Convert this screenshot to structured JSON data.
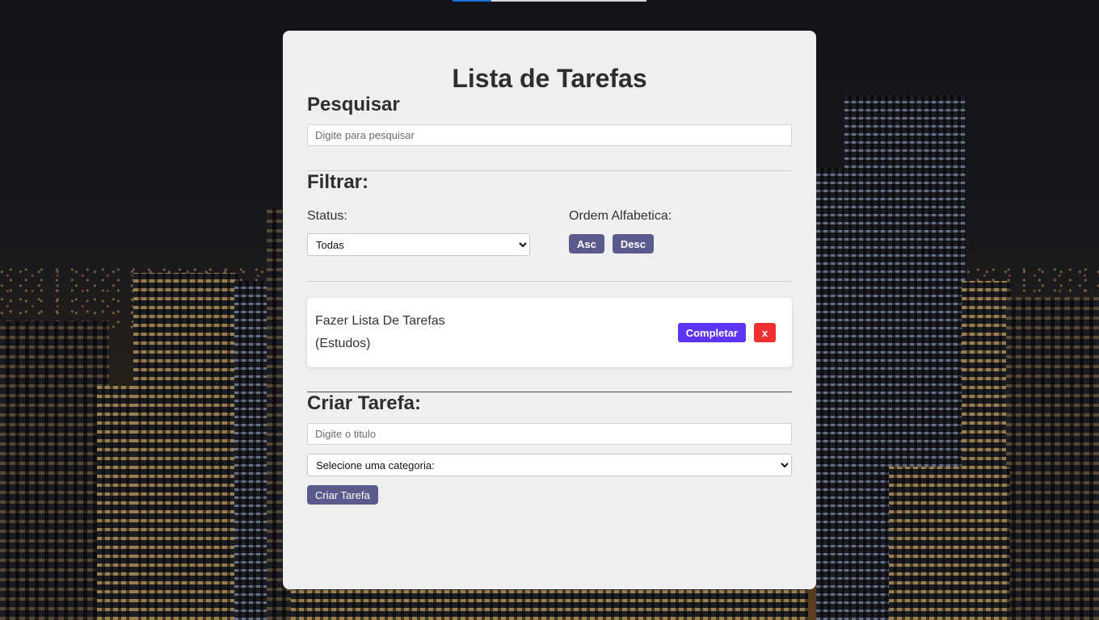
{
  "page": {
    "title": "Lista de Tarefas"
  },
  "search": {
    "heading": "Pesquisar",
    "placeholder": "Digite para pesquisar",
    "value": ""
  },
  "filter": {
    "heading": "Filtrar:",
    "status_label": "Status:",
    "status_selected": "Todas",
    "sort_label": "Ordem Alfabetica:",
    "asc_label": "Asc",
    "desc_label": "Desc"
  },
  "todos": [
    {
      "title": "Fazer Lista De Tarefas",
      "category": "(Estudos)",
      "complete_label": "Completar",
      "remove_label": "x"
    }
  ],
  "create": {
    "heading": "Criar Tarefa:",
    "title_placeholder": "Digite o titulo",
    "title_value": "",
    "category_selected": "Selecione uma categoria:",
    "submit_label": "Criar Tarefa"
  },
  "colors": {
    "card_bg": "#efefef",
    "sort_button": "#5a5a8c",
    "complete_button": "#5b34f5",
    "remove_button": "#ee3030",
    "top_progress": "#1e6fd9"
  },
  "top_loading_bar": {
    "progress_percent": 20
  }
}
